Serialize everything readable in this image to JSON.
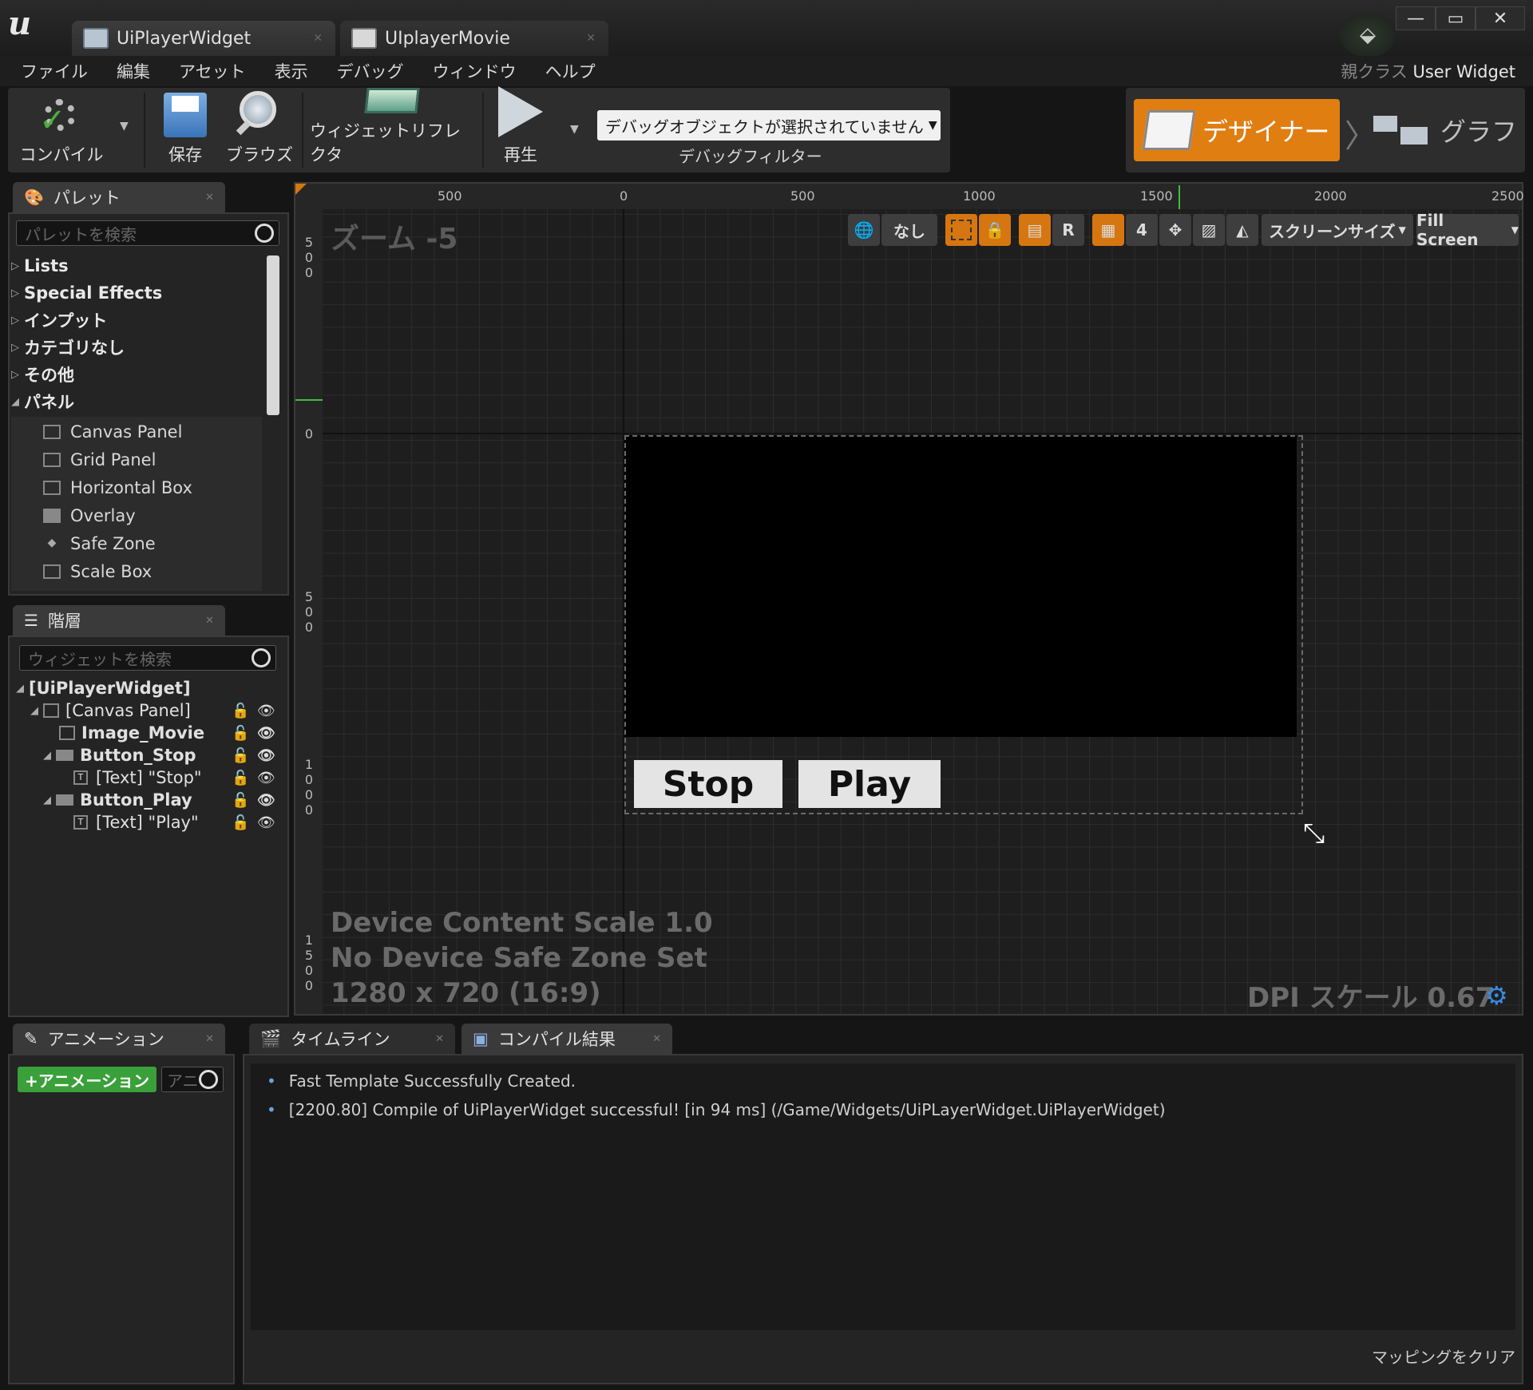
{
  "tabs": [
    {
      "label": "UiPlayerWidget"
    },
    {
      "label": "UIplayerMovie"
    }
  ],
  "menu": [
    "ファイル",
    "編集",
    "アセット",
    "表示",
    "デバッグ",
    "ウィンドウ",
    "ヘルプ"
  ],
  "parent_class": {
    "label": "親クラス",
    "value": "User Widget"
  },
  "toolbar": {
    "compile": "コンパイル",
    "save": "保存",
    "browse": "ブラウズ",
    "reflector": "ウィジェットリフレクタ",
    "play": "再生",
    "debug_object": "デバッグオブジェクトが選択されていません",
    "debug_filter": "デバッグフィルター"
  },
  "modes": {
    "designer": "デザイナー",
    "graph": "グラフ"
  },
  "palette": {
    "title": "パレット",
    "search_placeholder": "パレットを検索",
    "categories": [
      "Lists",
      "Special Effects",
      "インプット",
      "カテゴリなし",
      "その他",
      "パネル"
    ],
    "panel_items": [
      "Canvas Panel",
      "Grid Panel",
      "Horizontal Box",
      "Overlay",
      "Safe Zone",
      "Scale Box"
    ]
  },
  "hierarchy": {
    "title": "階層",
    "search_placeholder": "ウィジェットを検索",
    "items": [
      "[UiPlayerWidget]",
      "[Canvas Panel]",
      "Image_Movie",
      "Button_Stop",
      "[Text] \"Stop\"",
      "Button_Play",
      "[Text] \"Play\""
    ]
  },
  "canvas": {
    "zoom": "ズーム -5",
    "ruler_top": [
      "500",
      "0",
      "500",
      "1000",
      "1500",
      "2000",
      "2500"
    ],
    "none": "なし",
    "R": "R",
    "grid_snap": "4",
    "screen_size": "スクリーンサイズ",
    "fill_screen": "Fill Screen",
    "info": [
      "Device Content Scale 1.0",
      "No Device Safe Zone Set",
      "1280 x 720 (16:9)"
    ],
    "dpi": "DPI スケール 0.67",
    "stop_button": "Stop",
    "play_button": "Play"
  },
  "bottom": {
    "animation_tab": "アニメーション",
    "add_animation": "+アニメーション",
    "anim_search": "アニ",
    "timeline_tab": "タイムライン",
    "compile_tab": "コンパイル結果",
    "log": [
      "Fast Template Successfully Created.",
      "[2200.80] Compile of UiPlayerWidget successful! [in 94 ms] (/Game/Widgets/UiPLayerWidget.UiPlayerWidget)"
    ],
    "clear_mapping": "マッピングをクリア"
  }
}
